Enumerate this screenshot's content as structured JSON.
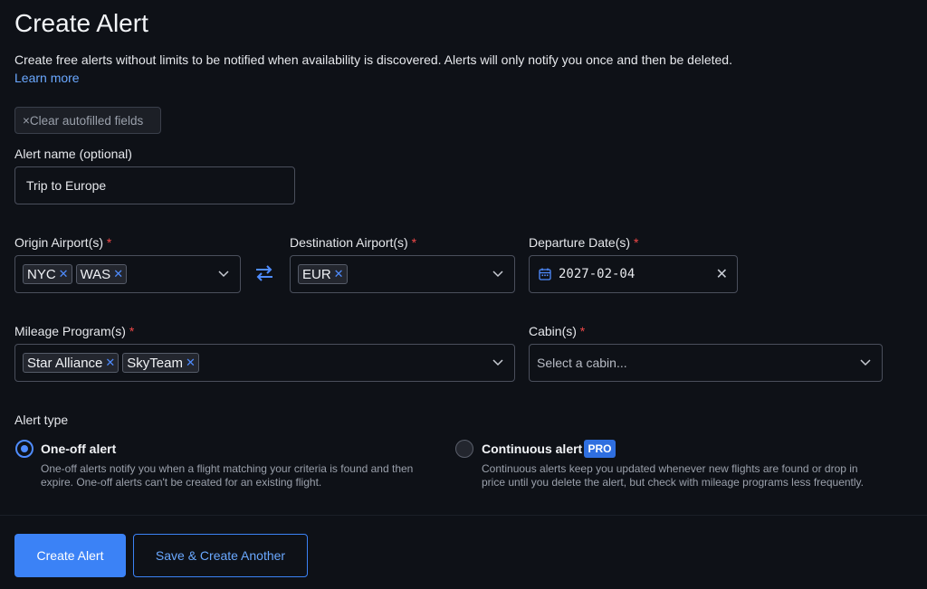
{
  "page": {
    "title": "Create Alert",
    "description": "Create free alerts without limits to be notified when availability is discovered. Alerts will only notify you once and then be deleted.",
    "learn_more": "Learn more"
  },
  "clear_button": {
    "icon": "close-icon",
    "label": "×Clear autofilled fields"
  },
  "alert_name": {
    "label": "Alert name (optional)",
    "value": "Trip to Europe"
  },
  "origin": {
    "label": "Origin Airport(s)",
    "required": "*",
    "chips": [
      "NYC",
      "WAS"
    ]
  },
  "destination": {
    "label": "Destination Airport(s)",
    "required": "*",
    "chips": [
      "EUR"
    ]
  },
  "departure": {
    "label": "Departure Date(s)",
    "required": "*",
    "value": "2027-02-04"
  },
  "mileage": {
    "label": "Mileage Program(s)",
    "required": "*",
    "chips": [
      "Star Alliance",
      "SkyTeam"
    ]
  },
  "cabin": {
    "label": "Cabin(s)",
    "required": "*",
    "placeholder": "Select a cabin..."
  },
  "alert_type": {
    "label": "Alert type",
    "options": [
      {
        "title": "One-off alert",
        "selected": true,
        "desc_line1": "One-off alerts notify you when a flight matching your criteria is found and then",
        "desc_line2": "expire. One-off alerts can't be created for an existing flight."
      },
      {
        "title": "Continuous alert",
        "selected": false,
        "badge": "PRO",
        "desc_line1": "Continuous alerts keep you updated whenever new flights are found or drop in",
        "desc_line2": "price until you delete the alert, but check with mileage programs less frequently."
      }
    ]
  },
  "actions": {
    "primary": "Create Alert",
    "secondary": "Save & Create Another"
  },
  "colors": {
    "accent": "#3b82f6",
    "required": "#f04848",
    "background": "#0e1117"
  }
}
